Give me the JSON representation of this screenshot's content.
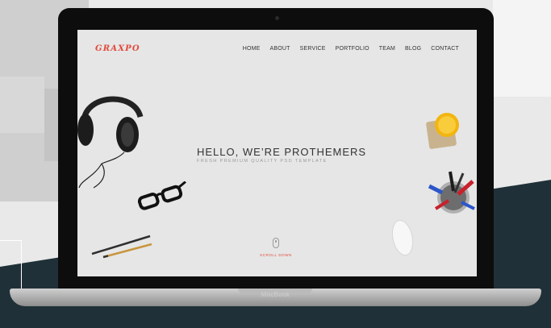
{
  "site": {
    "logo": "GRAXPO",
    "nav": [
      "HOME",
      "ABOUT",
      "SERVICE",
      "PORTFOLIO",
      "TEAM",
      "BLOG",
      "CONTACT"
    ],
    "hero": {
      "title": "HELLO, WE’RE PROTHEMERS",
      "subtitle": "FRESH PREMIUM QUALITY PSD TEMPLATE"
    },
    "scroll_label": "SCROLL DOWN"
  },
  "device": {
    "brand_label": "MacBook"
  },
  "colors": {
    "accent": "#e2493b",
    "backdrop_dark": "#203038",
    "screen_bg": "#e6e6e6"
  },
  "icons": [
    "headphones-icon",
    "glasses-icon",
    "pencil-icon",
    "coffee-cup-icon",
    "pen-holder-icon",
    "mouse-icon",
    "scroll-mouse-icon"
  ]
}
